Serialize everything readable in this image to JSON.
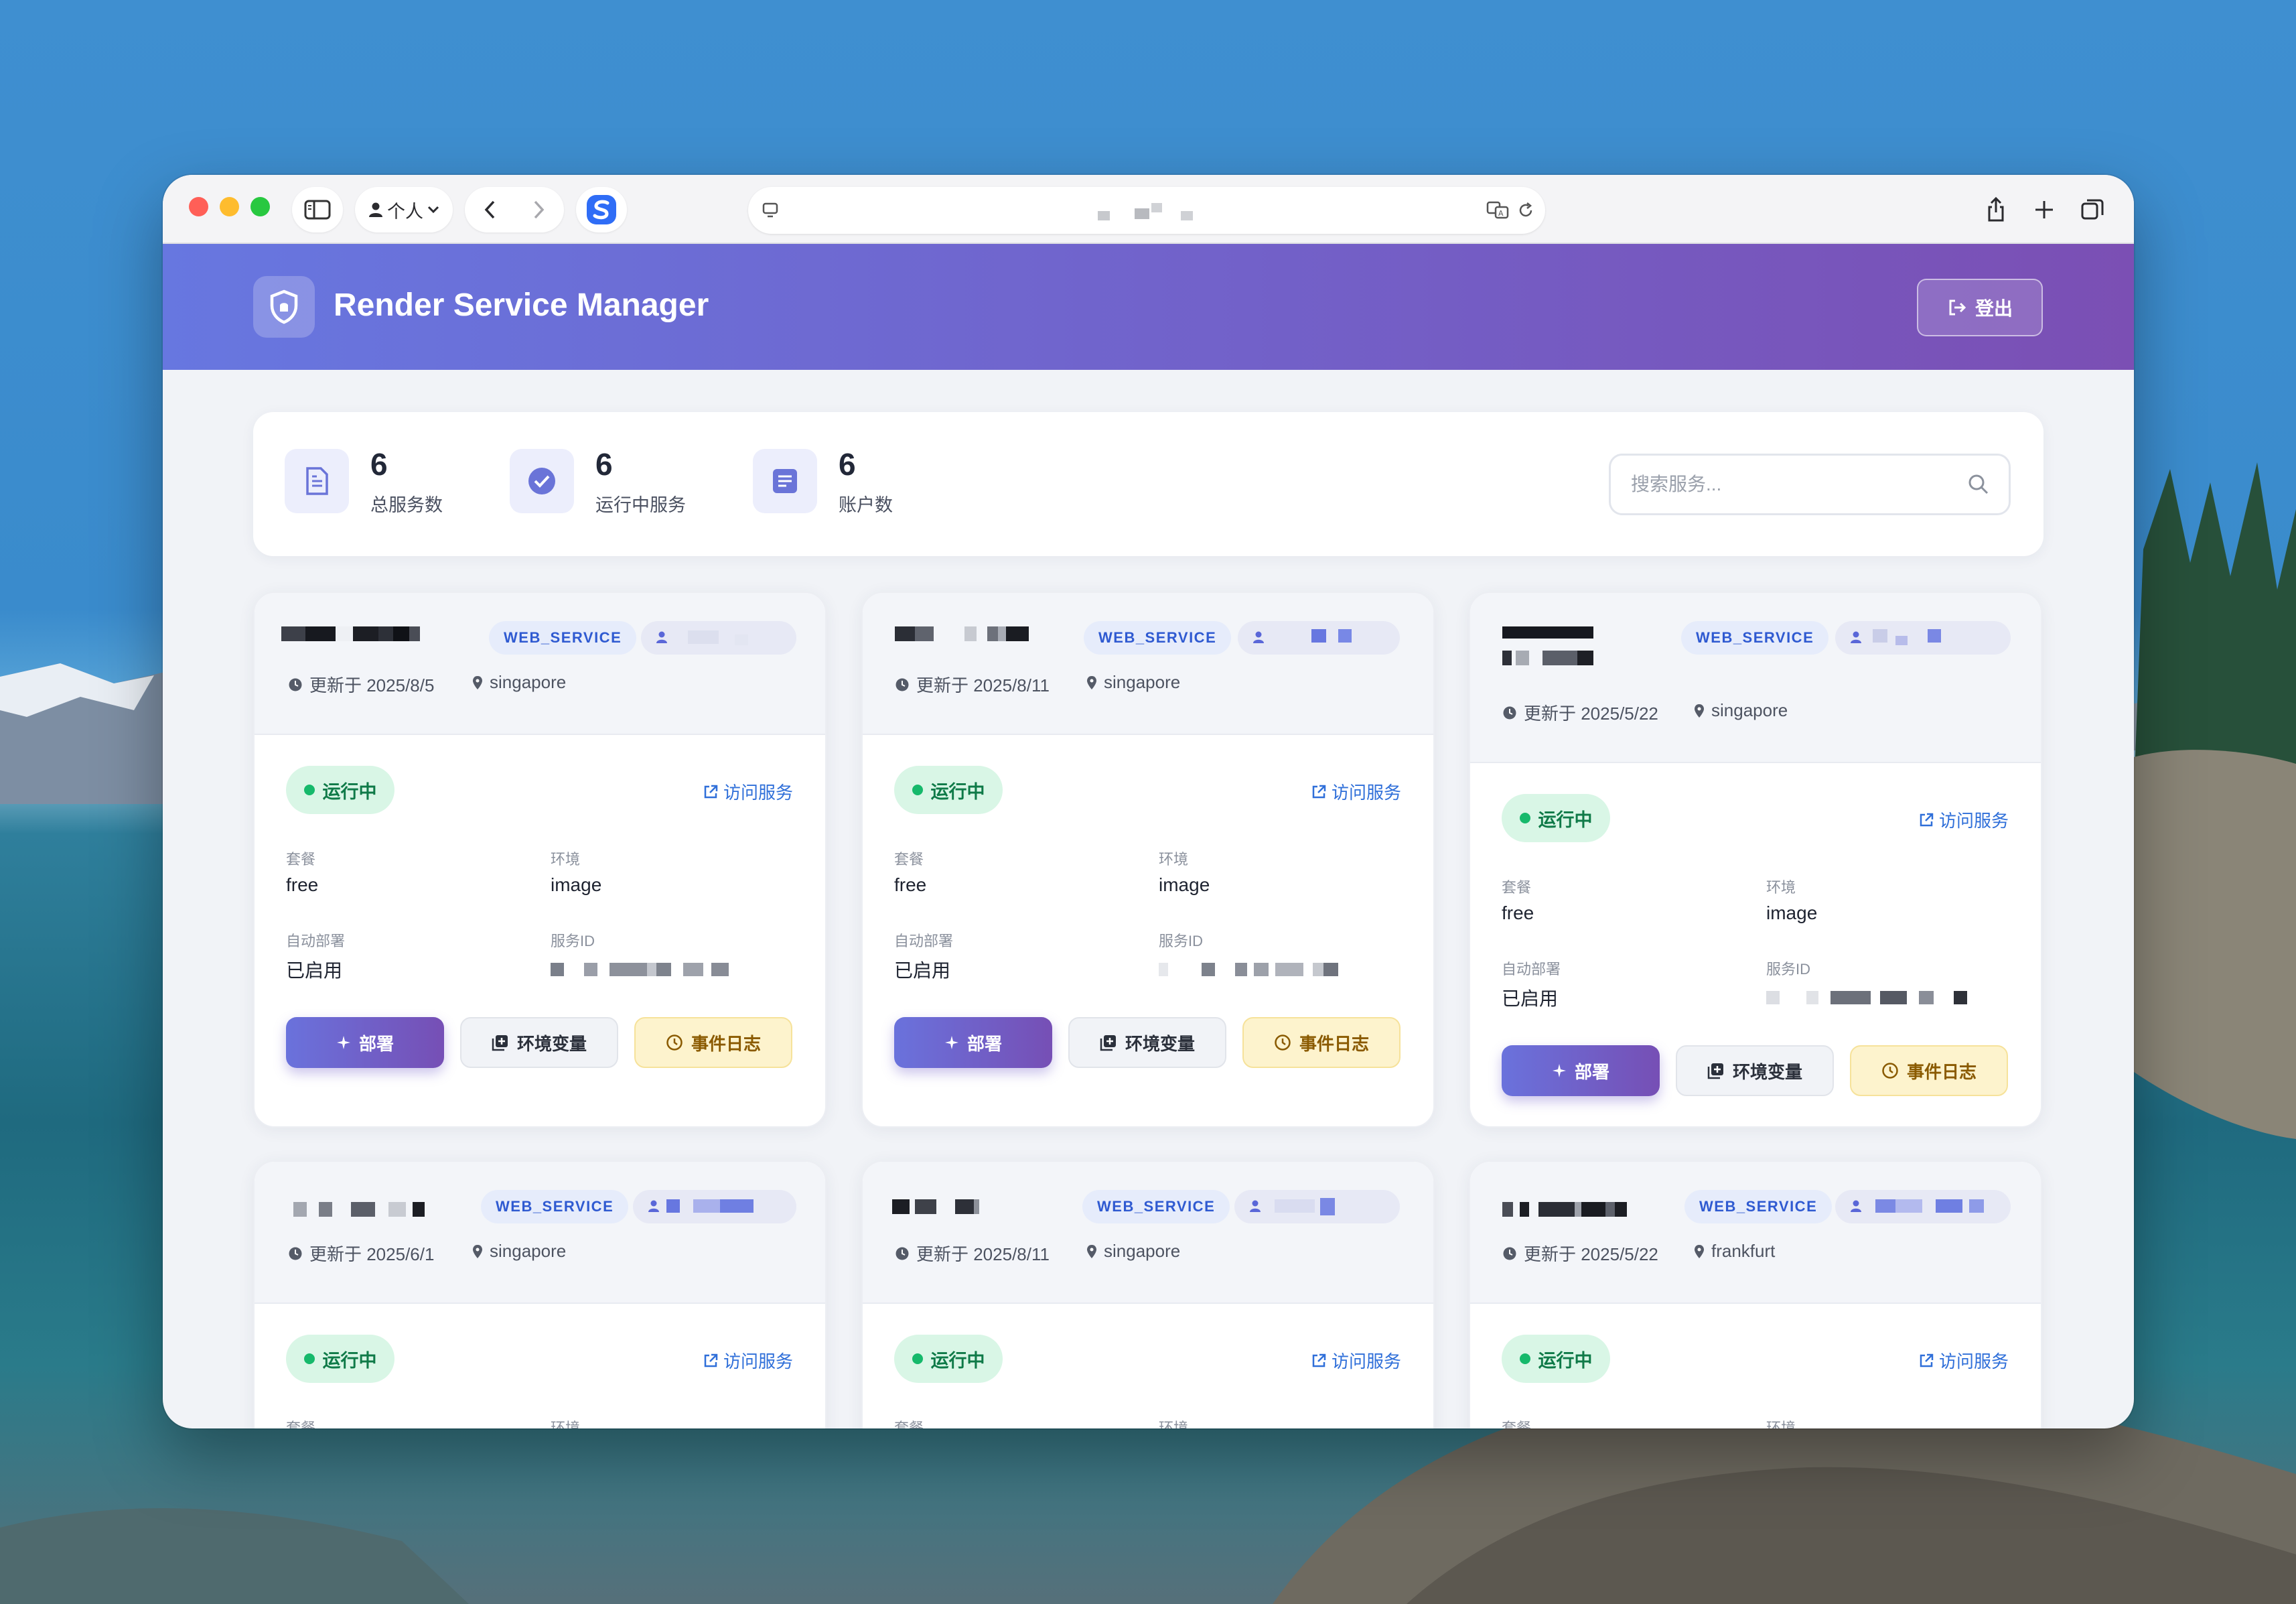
{
  "browser": {
    "profile_label": "个人",
    "url_display": "",
    "colors": {
      "close": "#ff5f57",
      "minimize": "#febc2e",
      "zoom": "#28c840"
    }
  },
  "header": {
    "title": "Render Service Manager",
    "logout_label": "登出",
    "icons": {
      "logo": "shield-icon",
      "logout": "logout-icon"
    },
    "gradient": [
      "#6777e0",
      "#7b4fb4"
    ]
  },
  "stats": [
    {
      "value": "6",
      "label": "总服务数",
      "icon": "document-icon"
    },
    {
      "value": "6",
      "label": "运行中服务",
      "icon": "check-circle-icon"
    },
    {
      "value": "6",
      "label": "账户数",
      "icon": "list-icon"
    }
  ],
  "search": {
    "placeholder": "搜索服务..."
  },
  "labels": {
    "plan": "套餐",
    "env": "环境",
    "auto_deploy": "自动部署",
    "service_id": "服务ID",
    "visit": "访问服务",
    "deploy": "部署",
    "env_vars": "环境变量",
    "events": "事件日志"
  },
  "services": [
    {
      "type": "WEB_SERVICE",
      "updated": "更新于 2025/8/5",
      "region": "singapore",
      "status": "运行中",
      "plan": "free",
      "env": "image",
      "auto_deploy": "已启用"
    },
    {
      "type": "WEB_SERVICE",
      "updated": "更新于 2025/8/11",
      "region": "singapore",
      "status": "运行中",
      "plan": "free",
      "env": "image",
      "auto_deploy": "已启用"
    },
    {
      "type": "WEB_SERVICE",
      "updated": "更新于 2025/5/22",
      "region": "singapore",
      "status": "运行中",
      "plan": "free",
      "env": "image",
      "auto_deploy": "已启用"
    },
    {
      "type": "WEB_SERVICE",
      "updated": "更新于 2025/6/1",
      "region": "singapore",
      "status": "运行中",
      "plan": "",
      "env": "",
      "auto_deploy": ""
    },
    {
      "type": "WEB_SERVICE",
      "updated": "更新于 2025/8/11",
      "region": "singapore",
      "status": "运行中",
      "plan": "",
      "env": "",
      "auto_deploy": ""
    },
    {
      "type": "WEB_SERVICE",
      "updated": "更新于 2025/5/22",
      "region": "frankfurt",
      "status": "运行中",
      "plan": "",
      "env": "",
      "auto_deploy": ""
    }
  ]
}
